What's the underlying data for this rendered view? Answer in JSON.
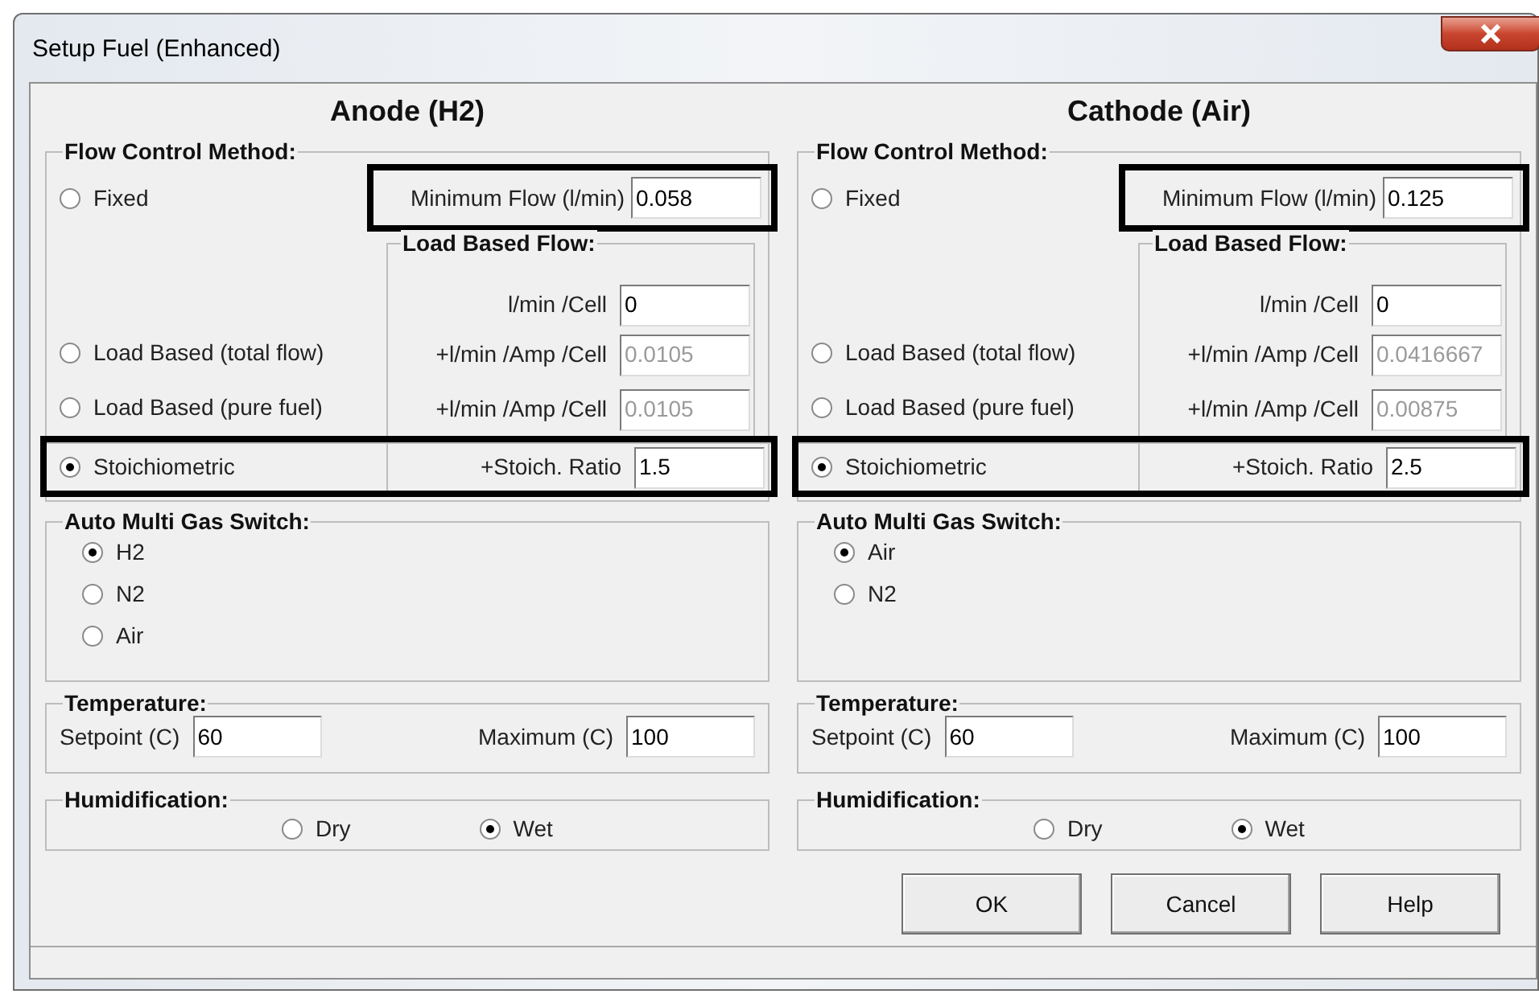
{
  "window": {
    "title": "Setup Fuel (Enhanced)"
  },
  "panels": [
    {
      "heading": "Anode (H2)",
      "flow_control": {
        "title": "Flow Control Method:",
        "methods": [
          {
            "label": "Fixed",
            "selected": false
          },
          {
            "label": "Load Based (total flow)",
            "selected": false
          },
          {
            "label": "Load Based (pure fuel)",
            "selected": false
          },
          {
            "label": "Stoichiometric",
            "selected": true
          }
        ],
        "minimum_flow": {
          "label": "Minimum Flow (l/min)",
          "value": "0.058",
          "highlighted": true
        },
        "load_based": {
          "title": "Load Based Flow:",
          "fields": [
            {
              "label": "l/min /Cell",
              "value": "0",
              "disabled": false
            },
            {
              "label": "+l/min /Amp /Cell",
              "value": "0.0105",
              "disabled": true
            },
            {
              "label": "+l/min /Amp /Cell",
              "value": "0.0105",
              "disabled": true
            }
          ]
        },
        "stoich_ratio": {
          "label": "+Stoich. Ratio",
          "value": "1.5",
          "highlighted": true
        }
      },
      "gas_switch": {
        "title": "Auto Multi Gas Switch:",
        "options": [
          {
            "label": "H2",
            "selected": true
          },
          {
            "label": "N2",
            "selected": false
          },
          {
            "label": "Air",
            "selected": false
          }
        ]
      },
      "temperature": {
        "title": "Temperature:",
        "setpoint": {
          "label": "Setpoint (C)",
          "value": "60"
        },
        "maximum": {
          "label": "Maximum (C)",
          "value": "100"
        }
      },
      "humidification": {
        "title": "Humidification:",
        "options": [
          {
            "label": "Dry",
            "selected": false
          },
          {
            "label": "Wet",
            "selected": true
          }
        ]
      }
    },
    {
      "heading": "Cathode (Air)",
      "flow_control": {
        "title": "Flow Control Method:",
        "methods": [
          {
            "label": "Fixed",
            "selected": false
          },
          {
            "label": "Load Based (total flow)",
            "selected": false
          },
          {
            "label": "Load Based (pure fuel)",
            "selected": false
          },
          {
            "label": "Stoichiometric",
            "selected": true
          }
        ],
        "minimum_flow": {
          "label": "Minimum Flow (l/min)",
          "value": "0.125",
          "highlighted": true
        },
        "load_based": {
          "title": "Load Based Flow:",
          "fields": [
            {
              "label": "l/min /Cell",
              "value": "0",
              "disabled": false
            },
            {
              "label": "+l/min /Amp /Cell",
              "value": "0.0416667",
              "disabled": true
            },
            {
              "label": "+l/min /Amp /Cell",
              "value": "0.00875",
              "disabled": true
            }
          ]
        },
        "stoich_ratio": {
          "label": "+Stoich. Ratio",
          "value": "2.5",
          "highlighted": true
        }
      },
      "gas_switch": {
        "title": "Auto Multi Gas Switch:",
        "options": [
          {
            "label": "Air",
            "selected": true
          },
          {
            "label": "N2",
            "selected": false
          }
        ]
      },
      "temperature": {
        "title": "Temperature:",
        "setpoint": {
          "label": "Setpoint (C)",
          "value": "60"
        },
        "maximum": {
          "label": "Maximum (C)",
          "value": "100"
        }
      },
      "humidification": {
        "title": "Humidification:",
        "options": [
          {
            "label": "Dry",
            "selected": false
          },
          {
            "label": "Wet",
            "selected": true
          }
        ]
      }
    }
  ],
  "buttons": [
    "OK",
    "Cancel",
    "Help"
  ]
}
